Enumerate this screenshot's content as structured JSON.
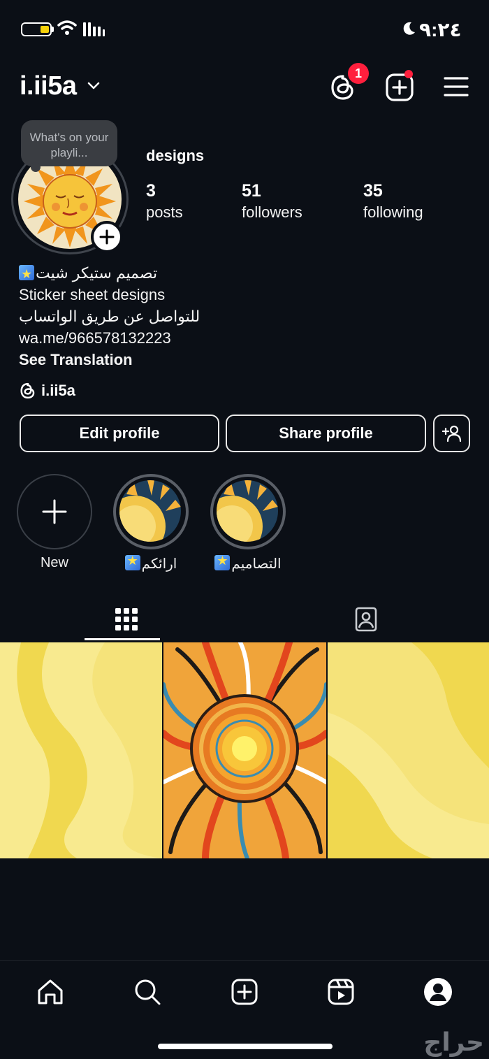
{
  "status_bar": {
    "time": "٩:٢٤",
    "battery_level": 0.3,
    "icons": [
      "battery-icon",
      "wifi-icon",
      "signal-icon",
      "moon-icon"
    ]
  },
  "header": {
    "username": "i.ii5a",
    "threads_badge_count": "1",
    "icons": [
      "chevron-down-icon",
      "threads-icon",
      "create-icon",
      "menu-icon"
    ]
  },
  "profile": {
    "note": "What's on your playli...",
    "category": "designs",
    "stats": [
      {
        "value": "3",
        "label": "posts"
      },
      {
        "value": "51",
        "label": "followers"
      },
      {
        "value": "35",
        "label": "following"
      }
    ],
    "bio": {
      "line1": "تصميم ستيكر شيت",
      "line2": "Sticker sheet designs",
      "line3": "للتواصل عن طريق الواتساب",
      "line4": "wa.me/966578132223",
      "see_translation": "See Translation"
    },
    "threads_handle": "i.ii5a"
  },
  "actions": {
    "edit_profile": "Edit profile",
    "share_profile": "Share profile"
  },
  "highlights": [
    {
      "label": "New"
    },
    {
      "label": "ارائكم"
    },
    {
      "label": "التصاميم"
    }
  ],
  "tabs": [
    "grid-icon",
    "tagged-icon"
  ],
  "posts_count_visible": 3,
  "bottom_nav": [
    "home-icon",
    "search-icon",
    "create-icon",
    "reels-icon",
    "profile-icon"
  ],
  "watermark": "حراج",
  "colors": {
    "background": "#0b0f16",
    "badge_red": "#ff1f3d",
    "sun_orange": "#f2951e",
    "sun_yellow": "#f6d84a",
    "post_yellow": "#f3e27a"
  }
}
